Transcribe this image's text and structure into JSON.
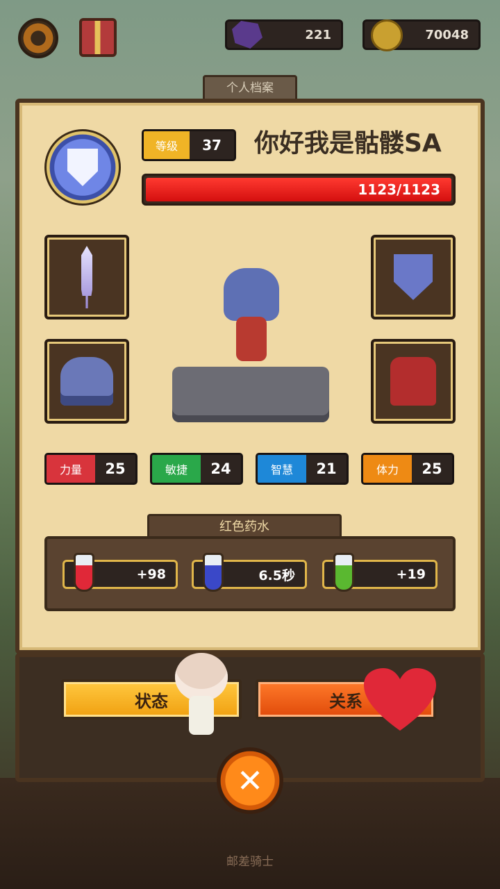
{
  "currency": {
    "gems": "221",
    "coins": "70048"
  },
  "tab_title": "个人档案",
  "player": {
    "level_label": "等级",
    "level": "37",
    "name": "你好我是骷髅SA",
    "hp": "1123/1123",
    "hp_fraction": 1.0
  },
  "stats": [
    {
      "label": "力量",
      "value": "25",
      "color": "#d8343c"
    },
    {
      "label": "敏捷",
      "value": "24",
      "color": "#2aa84a"
    },
    {
      "label": "智慧",
      "value": "21",
      "color": "#1e88d8"
    },
    {
      "label": "体力",
      "value": "25",
      "color": "#ee8a14"
    }
  ],
  "potion": {
    "title": "红色药水",
    "effects": [
      {
        "value": "+98",
        "icon": "heart-plus-icon",
        "color": "#e02838"
      },
      {
        "value": "6.5秒",
        "icon": "hourglass-icon",
        "color": "#3a48c8"
      },
      {
        "value": "+19",
        "icon": "shield-up-icon",
        "color": "#5ab830"
      }
    ]
  },
  "buttons": {
    "status": "状态",
    "relation": "关系"
  },
  "footer": "邮差骑士"
}
